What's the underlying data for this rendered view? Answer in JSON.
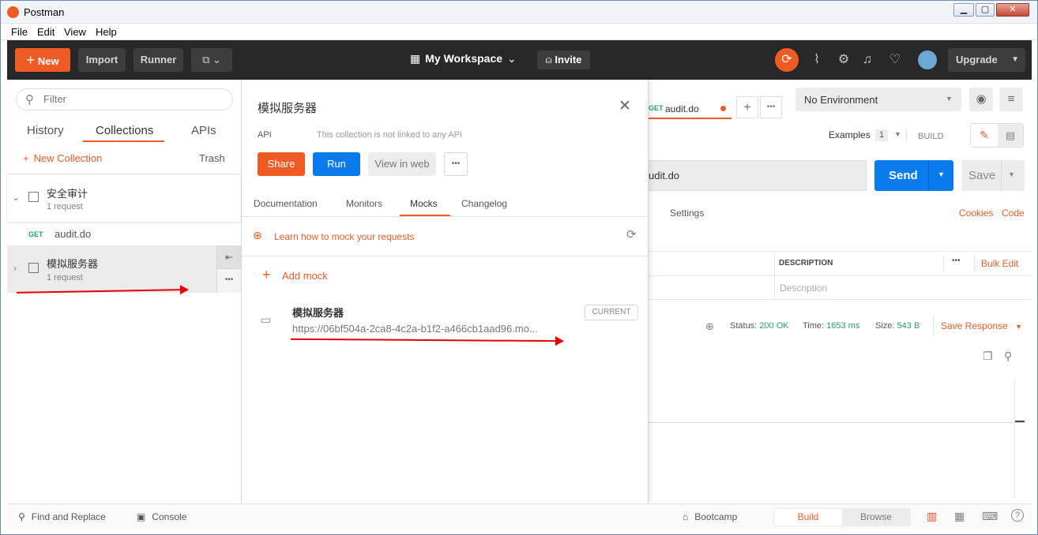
{
  "window": {
    "title": "Postman",
    "minimize": "▁",
    "maximize": "▢",
    "close": "✕"
  },
  "menu": [
    "File",
    "Edit",
    "View",
    "Help"
  ],
  "header": {
    "new_label": "New",
    "import_label": "Import",
    "runner_label": "Runner",
    "workspace_label": "My Workspace",
    "invite_label": "Invite",
    "upgrade_label": "Upgrade"
  },
  "sidebar": {
    "filter_placeholder": "Filter",
    "tabs": [
      "History",
      "Collections",
      "APIs"
    ],
    "new_collection": "New Collection",
    "trash": "Trash",
    "collections": [
      {
        "name": "安全审计",
        "count": "1 request"
      },
      {
        "name": "模拟服务器",
        "count": "1 request"
      }
    ],
    "request": {
      "method": "GET",
      "name": "audit.do"
    }
  },
  "panel": {
    "title": "模拟服务器",
    "api_label": "API",
    "api_note": "This collection is not linked to any API",
    "share": "Share",
    "run": "Run",
    "view_web": "View in web",
    "tabs": [
      "Documentation",
      "Monitors",
      "Mocks",
      "Changelog"
    ],
    "active_tab": "Mocks",
    "learn": "Learn how to mock your requests",
    "add_mock": "Add mock",
    "mock": {
      "name": "模拟服务器",
      "url": "https://06bf504a-2ca8-4c2a-b1f2-a466cb1aad96.mo...",
      "badge": "CURRENT"
    }
  },
  "main": {
    "tab": {
      "method": "GET",
      "name": "audit.do"
    },
    "environment": "No Environment",
    "examples_label": "Examples",
    "examples_count": "1",
    "build_label": "BUILD",
    "url_text": "udit.do",
    "send": "Send",
    "save": "Save",
    "settings": "Settings",
    "cookies": "Cookies",
    "code": "Code",
    "description_header": "DESCRIPTION",
    "bulk_edit": "Bulk Edit",
    "description_placeholder": "Description",
    "status_label": "Status:",
    "status_value": "200 OK",
    "time_label": "Time:",
    "time_value": "1653 ms",
    "size_label": "Size:",
    "size_value": "543 B",
    "save_response": "Save Response"
  },
  "footer": {
    "find_replace": "Find and Replace",
    "console": "Console",
    "bootcamp": "Bootcamp",
    "build": "Build",
    "browse": "Browse"
  },
  "colors": {
    "accent": "#ef5b25",
    "send_blue": "#097bed",
    "header_bg": "#282828",
    "status_green": "#26a069"
  }
}
